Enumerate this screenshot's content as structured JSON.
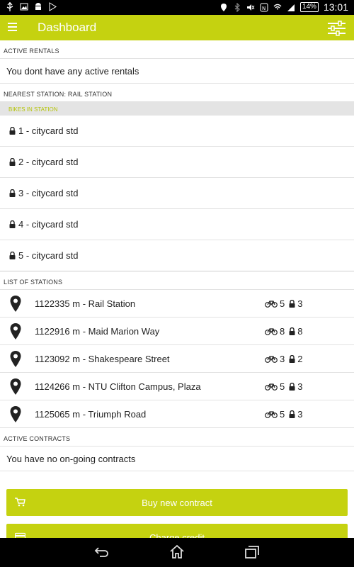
{
  "status_bar": {
    "battery": "14%",
    "time": "13:01"
  },
  "app_bar": {
    "title": "Dashboard",
    "menu_icon": "hamburger-menu-icon",
    "filter_icon": "sliders-icon"
  },
  "active_rentals": {
    "header": "ACTIVE RENTALS",
    "message": "You dont have any active rentals"
  },
  "nearest_station": {
    "header": "NEAREST STATION: RAIL STATION",
    "subheader": "BIKES IN STATION",
    "bikes": [
      {
        "label": "1 - citycard std"
      },
      {
        "label": "2 - citycard std"
      },
      {
        "label": "3 - citycard std"
      },
      {
        "label": "4 - citycard std"
      },
      {
        "label": "5 - citycard std"
      }
    ]
  },
  "stations": {
    "header": "LIST OF STATIONS",
    "items": [
      {
        "name": "1122335 m - Rail Station",
        "bikes": "5",
        "locks": "3"
      },
      {
        "name": "1122916 m - Maid Marion Way",
        "bikes": "8",
        "locks": "8"
      },
      {
        "name": "1123092 m - Shakespeare Street",
        "bikes": "3",
        "locks": "2"
      },
      {
        "name": "1124266 m - NTU Clifton Campus, Plaza",
        "bikes": "5",
        "locks": "3"
      },
      {
        "name": "1125065 m - Triumph Road",
        "bikes": "5",
        "locks": "3"
      }
    ]
  },
  "active_contracts": {
    "header": "ACTIVE CONTRACTS",
    "message": "You have no on-going contracts"
  },
  "buttons": {
    "buy_contract": "Buy new contract",
    "charge_credit": "Charge credit"
  },
  "colors": {
    "accent": "#c5d210",
    "subheader_text": "#b5c40a"
  }
}
